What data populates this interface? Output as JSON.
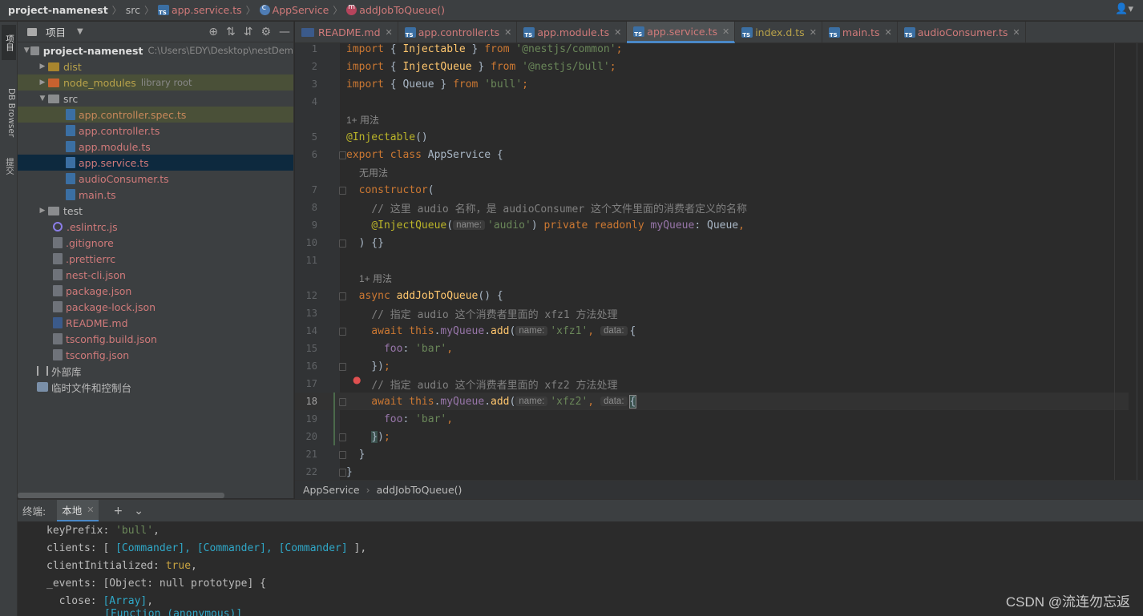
{
  "navbar": {
    "project": "project-namenest",
    "folder": "src",
    "file": "app.service.ts",
    "class": "AppService",
    "method": "addJobToQueue()"
  },
  "side_tabs": {
    "project": "项目",
    "db_browser": "DB Browser",
    "commit": "提交"
  },
  "project_panel": {
    "title": "项目",
    "root_name": "project-namenest",
    "root_path": "C:\\Users\\EDY\\Desktop\\nestDem",
    "items": [
      {
        "label": "dist",
        "note": ""
      },
      {
        "label": "node_modules",
        "note": "library root"
      },
      {
        "label": "src",
        "note": ""
      },
      {
        "label": "app.controller.spec.ts",
        "note": ""
      },
      {
        "label": "app.controller.ts",
        "note": ""
      },
      {
        "label": "app.module.ts",
        "note": ""
      },
      {
        "label": "app.service.ts",
        "note": ""
      },
      {
        "label": "audioConsumer.ts",
        "note": ""
      },
      {
        "label": "main.ts",
        "note": ""
      },
      {
        "label": "test",
        "note": ""
      },
      {
        "label": ".eslintrc.js",
        "note": ""
      },
      {
        "label": ".gitignore",
        "note": ""
      },
      {
        "label": ".prettierrc",
        "note": ""
      },
      {
        "label": "nest-cli.json",
        "note": ""
      },
      {
        "label": "package.json",
        "note": ""
      },
      {
        "label": "package-lock.json",
        "note": ""
      },
      {
        "label": "README.md",
        "note": ""
      },
      {
        "label": "tsconfig.build.json",
        "note": ""
      },
      {
        "label": "tsconfig.json",
        "note": ""
      },
      {
        "label": "外部库",
        "note": ""
      },
      {
        "label": "临时文件和控制台",
        "note": ""
      }
    ]
  },
  "tabs": [
    {
      "label": "README.md"
    },
    {
      "label": "app.controller.ts"
    },
    {
      "label": "app.module.ts"
    },
    {
      "label": "app.service.ts"
    },
    {
      "label": "index.d.ts"
    },
    {
      "label": "main.ts"
    },
    {
      "label": "audioConsumer.ts"
    }
  ],
  "editor": {
    "line_numbers": [
      "1",
      "2",
      "3",
      "4",
      "5",
      "6",
      "7",
      "8",
      "9",
      "10",
      "11",
      "12",
      "13",
      "14",
      "15",
      "16",
      "17",
      "18",
      "19",
      "20",
      "21",
      "22"
    ],
    "current_line": "18",
    "usage_hints": {
      "injectable": "1+ 用法",
      "constructor": "无用法",
      "method": "1+ 用法"
    },
    "inlay": {
      "name": "name:",
      "data": "data:"
    },
    "code": {
      "l1_from": "'@nestjs/common'",
      "l2_from": "'@nestjs/bull'",
      "l3_from": "'bull'",
      "l8_comment": "// 这里 audio 名称，是 audioConsumer 这个文件里面的消费者定义的名称",
      "l9_arg": "'audio'",
      "l13_comment": "// 指定 audio 这个消费者里面的 xfz1 方法处理",
      "l14_arg": "'xfz1'",
      "l15_val": "'bar'",
      "l17_comment": "// 指定 audio 这个消费者里面的 xfz2 方法处理",
      "l18_arg": "'xfz2'",
      "l19_val": "'bar'"
    }
  },
  "breadcrumb": {
    "class": "AppService",
    "method": "addJobToQueue()"
  },
  "terminal": {
    "label": "终端:",
    "tab": "本地",
    "lines": {
      "l1_key": "keyPrefix: ",
      "l1_val": "'bull'",
      "l2_key": "clients: [ ",
      "l2_items": "[Commander], [Commander], [Commander]",
      "l2_end": " ],",
      "l3_key": "clientInitialized: ",
      "l3_val": "true",
      "l4_text": "_events: [Object: null prototype] {",
      "l5_key": "  close: ",
      "l5_val": "[Array]",
      "l6_val": "[Function (anonymous)]"
    }
  },
  "watermark": "CSDN @流连勿忘返"
}
